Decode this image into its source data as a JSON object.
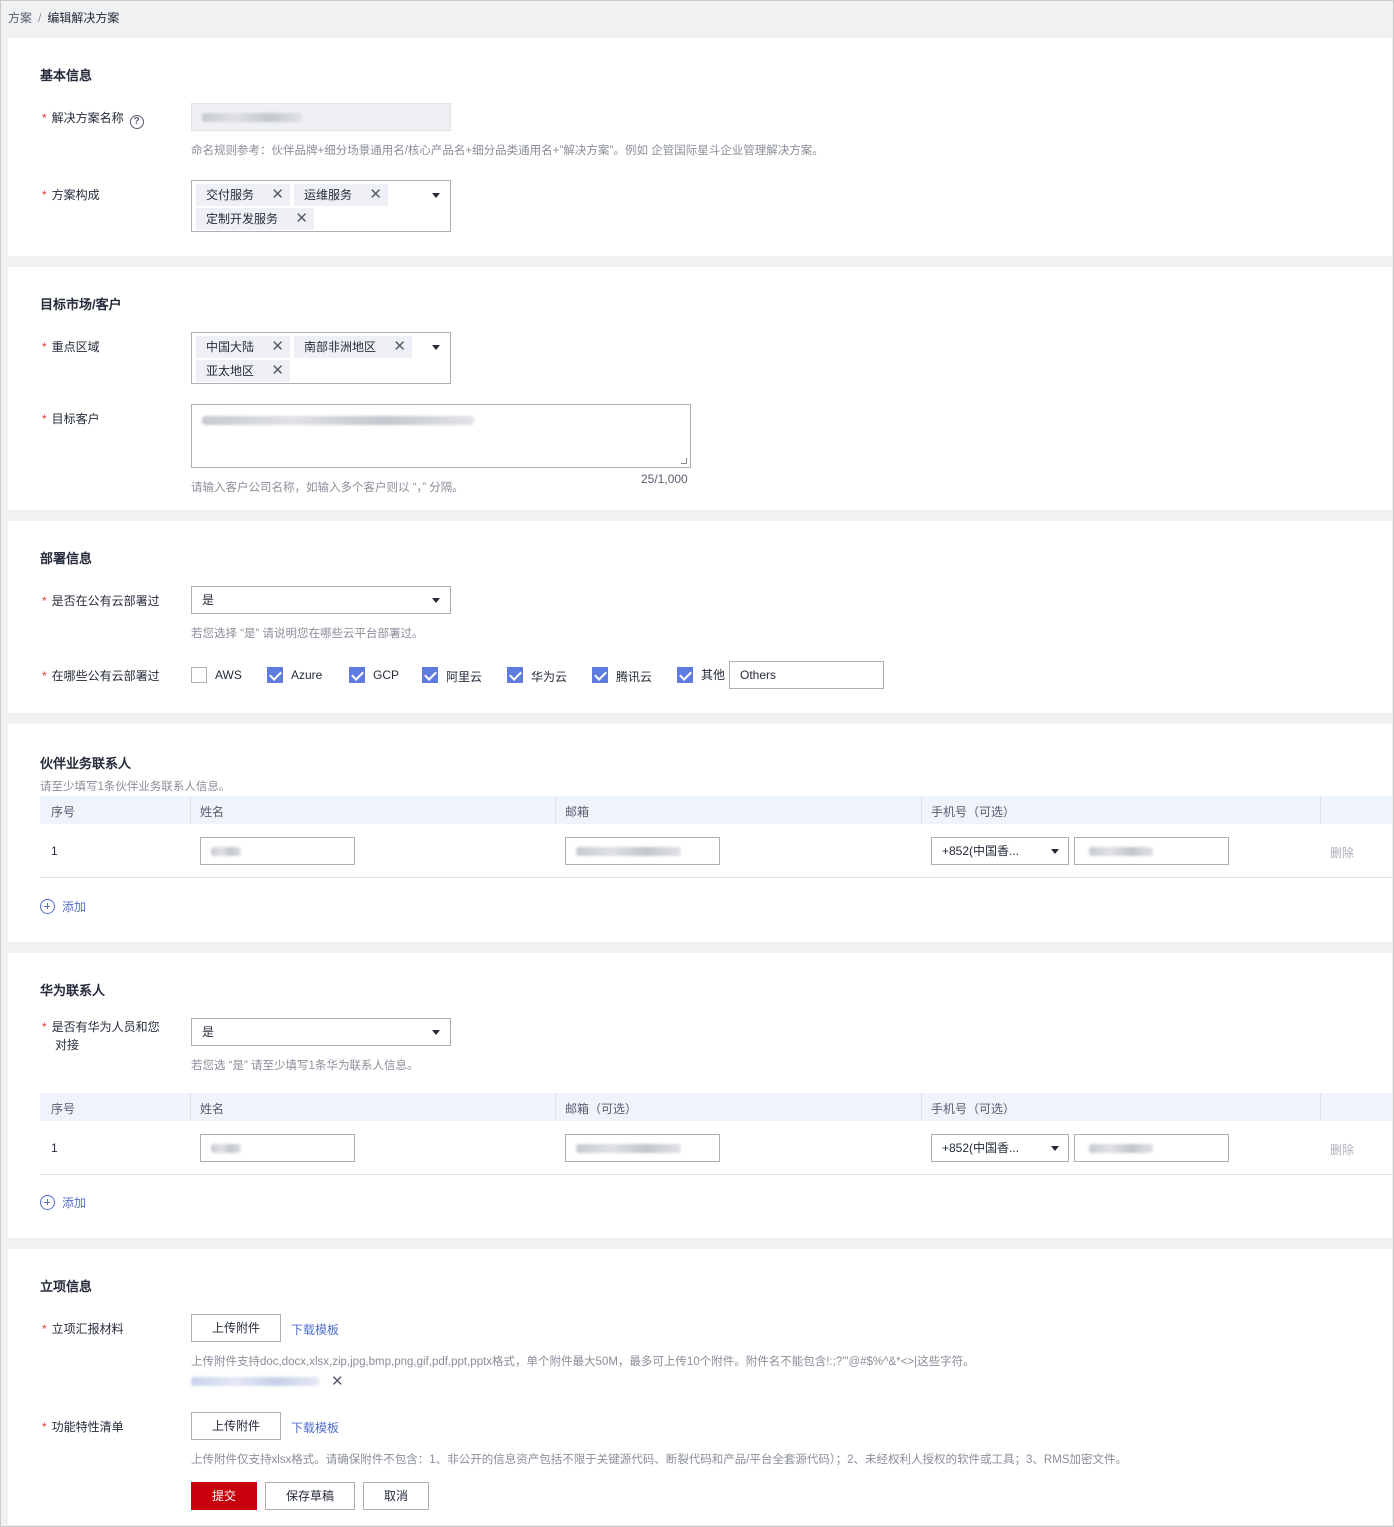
{
  "breadcrumb": {
    "root": "方案",
    "current": "编辑解决方案"
  },
  "basic": {
    "title": "基本信息",
    "name_label": "解决方案名称",
    "name_hint": "命名规则参考：伙伴品牌+细分场景通用名/核心产品名+细分品类通用名+\"解决方案\"。例如 企管国际星斗企业管理解决方案。",
    "composition_label": "方案构成",
    "composition_tags": [
      "交付服务",
      "运维服务",
      "定制开发服务"
    ]
  },
  "market": {
    "title": "目标市场/客户",
    "region_label": "重点区域",
    "region_tags": [
      "中国大陆",
      "南部非洲地区",
      "亚太地区"
    ],
    "customer_label": "目标客户",
    "customer_counter": "25/1,000",
    "customer_hint": "请输入客户公司名称，如输入多个客户则以 “，” 分隔。"
  },
  "deploy": {
    "title": "部署信息",
    "public_cloud_label": "是否在公有云部署过",
    "public_cloud_value": "是",
    "public_cloud_hint": "若您选择 “是” 请说明您在哪些云平台部署过。",
    "which_cloud_label": "在哪些公有云部署过",
    "clouds": [
      {
        "label": "AWS",
        "checked": false
      },
      {
        "label": "Azure",
        "checked": true
      },
      {
        "label": "GCP",
        "checked": true
      },
      {
        "label": "阿里云",
        "checked": true
      },
      {
        "label": "华为云",
        "checked": true
      },
      {
        "label": "腾讯云",
        "checked": true
      },
      {
        "label": "其他",
        "checked": true
      }
    ],
    "other_value": "Others"
  },
  "partner_contact": {
    "title": "伙伴业务联系人",
    "subtitle": "请至少填写1条伙伴业务联系人信息。",
    "columns": [
      "序号",
      "姓名",
      "邮箱",
      "手机号（可选）"
    ],
    "rows": [
      {
        "index": "1",
        "country_code": "+852(中国香...",
        "delete": "删除"
      }
    ],
    "add_label": "添加"
  },
  "huawei_contact": {
    "title": "华为联系人",
    "has_label_1": "是否有华为人员和您",
    "has_label_2": "对接",
    "has_value": "是",
    "hint": "若您选 “是” 请至少填写1条华为联系人信息。",
    "columns": [
      "序号",
      "姓名",
      "邮箱（可选）",
      "手机号（可选）"
    ],
    "rows": [
      {
        "index": "1",
        "country_code": "+852(中国香...",
        "delete": "删除"
      }
    ],
    "add_label": "添加"
  },
  "project": {
    "title": "立项信息",
    "report_label": "立项汇报材料",
    "upload_label": "上传附件",
    "download_label": "下载模板",
    "report_hint": "上传附件支持doc,docx,xlsx,zip,jpg,bmp,png,gif,pdf,ppt,pptx格式，单个附件最大50M，最多可上传10个附件。附件名不能包含!:;?'\"@#$%^&*<>|这些字符。",
    "feature_label": "功能特性清单",
    "feature_hint": "上传附件仅支持xlsx格式。请确保附件不包含：1、非公开的信息资产包括不限于关键源代码、断裂代码和产品/平台全套源代码）；2、未经权利人授权的软件或工具；3、RMS加密文件。"
  },
  "actions": {
    "submit": "提交",
    "save_draft": "保存草稿",
    "cancel": "取消"
  }
}
